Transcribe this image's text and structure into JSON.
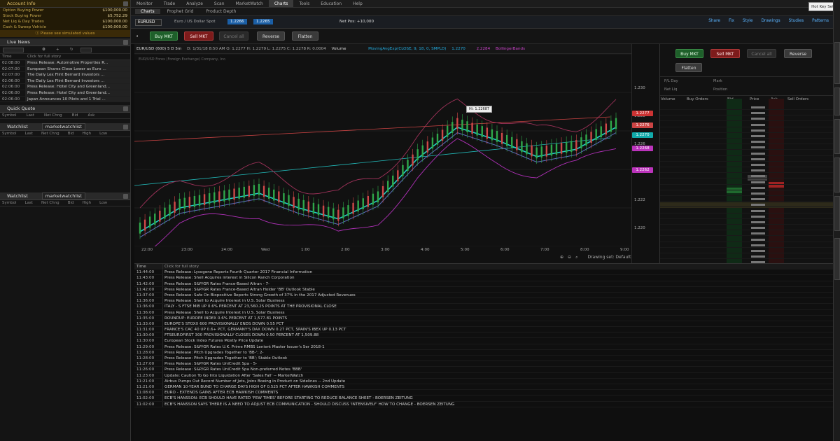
{
  "colors": {
    "buy": "#1e5f2a",
    "sell": "#7d1b1b",
    "accent": "#3aa0d8",
    "teal": "#23d0c8",
    "red_line": "#c44",
    "magenta": "#c030c0"
  },
  "left_panel": {
    "account_title": "Account Info",
    "account_rows": [
      {
        "label": "Option Buying Power",
        "value": "$100,000.00"
      },
      {
        "label": "Stock Buying Power",
        "value": "$5,752.29"
      },
      {
        "label": "Net Liq & Day Trades",
        "value": "$100,000.00"
      },
      {
        "label": "Cash & Sweep Vehicle",
        "value": "$100,000.00"
      }
    ],
    "account_note": "ⓘ Please see simulated values",
    "live_news_title": "Live News",
    "news_header": {
      "time": "Time",
      "headline": "Click for full story"
    },
    "news_items": [
      {
        "time": "02:08:00",
        "headline": "Press Release: Automotive Properties R..."
      },
      {
        "time": "02:07:00",
        "headline": "European Shares Close Lower as Euro ..."
      },
      {
        "time": "02:07:00",
        "headline": "The Daily Lex Flint Bernard Investors ..."
      },
      {
        "time": "02:06:00",
        "headline": "The Daily Lex Flint Bernard Investors ..."
      },
      {
        "time": "02:06:00",
        "headline": "Press Release: Hotel City and Greenland..."
      },
      {
        "time": "02:06:00",
        "headline": "Press Release: Hotel City and Greenland..."
      },
      {
        "time": "02:06:00",
        "headline": "Japan Announces 10 Pilots and 1 Trial ..."
      }
    ],
    "quick_quote_title": "Quick Quote",
    "quick_quote_cols": [
      "Symbol",
      "Last",
      "Net Chng",
      "Bid",
      "Ask"
    ],
    "watchlist1_title": "Watchlist",
    "watchlist1_name": "marketwatchlist",
    "watchlist_cols": [
      "Symbol",
      "Last",
      "Net Chng",
      "Bid",
      "High",
      "Low"
    ],
    "watchlist2_title": "Watchlist",
    "watchlist2_name": "marketwatchlist"
  },
  "menu": {
    "tabs": [
      "Monitor",
      "Trade",
      "Analyze",
      "Scan",
      "MarketWatch",
      "Charts",
      "Tools",
      "Education",
      "Help"
    ],
    "active": "Charts",
    "sub_tabs": [
      "Charts",
      "Prophet Grid",
      "Product Depth"
    ],
    "tooltip": "Hot Key Setu"
  },
  "symbar": {
    "symbol": "EURUSD",
    "desc": "Euro / US Dollar Spot",
    "last": "1.2266",
    "bid": "1.2265",
    "net_pos": "Net Pos: +10,000",
    "tools": [
      "Share",
      "Fix",
      "Style",
      "Drawings",
      "Studies",
      "Patterns"
    ]
  },
  "trade_buttons": {
    "buy": "Buy MKT",
    "sell": "Sell MKT",
    "cancel": "Cancel all",
    "reverse": "Reverse",
    "flatten": "Flatten"
  },
  "chart": {
    "header": "EUR/USD (600) 5 D 5m",
    "ohlc": "D: 1/31/18 8:50 AM   O: 1.2277   H: 1.2279   L: 1.2275   C: 1.2278   R: 0.0004",
    "studies": "Volume",
    "ma_label": "MovingAvgExp(CLOSE, 9, 18, 0, SMPLD)",
    "ma_val": "1.2270",
    "bb_val": "2.2284",
    "bb_label": "BollingerBands",
    "source": "EUR/USD Forex (Foreign Exchange) Company, Inc.",
    "price_label": "Hi: 1.22687",
    "x_ticks": [
      "22:00",
      "23:00",
      "24:00",
      "Wed",
      "1:00",
      "2:00",
      "3:00",
      "4:00",
      "5:00",
      "6:00",
      "7:00",
      "8:00",
      "9:00",
      "4:00",
      "5:00",
      "6:00",
      "7:00",
      "8:00",
      "9:00"
    ],
    "y_ticks": [
      "1.230",
      "1.228",
      "1.226",
      "1.224",
      "1.222",
      "1.220"
    ],
    "y_tags": [
      {
        "text": "1.2277",
        "color": "#c33"
      },
      {
        "text": "1.2276",
        "color": "#c44"
      },
      {
        "text": "1.2270",
        "color": "#1aa"
      },
      {
        "text": "1.2268",
        "color": "#b3b"
      },
      {
        "text": "1.2262",
        "color": "#b3b"
      }
    ],
    "drawing_set": "Drawing set: Default"
  },
  "chart_data": {
    "type": "line",
    "x": [
      "22:00",
      "23:00",
      "24:00",
      "Wed",
      "1:00",
      "2:00",
      "3:00",
      "4:00",
      "5:00",
      "6:00",
      "7:00",
      "8:00",
      "9:00"
    ],
    "series": [
      {
        "name": "",
        "values": [
          1.2205,
          1.2218,
          1.2222,
          1.2226,
          1.2218,
          1.2212,
          1.2222,
          1.2245,
          1.2262,
          1.2255,
          1.2246,
          1.225,
          1.2262
        ]
      }
    ],
    "ylim": [
      1.2195,
      1.23
    ]
  },
  "ladder": {
    "buttons": {
      "buy": "Buy MKT",
      "sell": "Sell MKT",
      "cancel": "Cancel all",
      "reverse": "Reverse",
      "flatten": "Flatten"
    },
    "cols": [
      "Volume",
      "Buy Orders",
      "Bid",
      "Price",
      "Ask",
      "Sell Orders"
    ],
    "info": [
      "P/L Day",
      "Mark",
      "Net Liq",
      "Position"
    ]
  },
  "bottom_news": {
    "header": {
      "time": "Time",
      "headline": "Click for full story"
    },
    "items": [
      {
        "time": "11:44:00",
        "headline": "Press Release: Lysogene Reports Fourth Quarter 2017 Financial Information"
      },
      {
        "time": "11:43:00",
        "headline": "Press Release: Shell Acquires interest in Silicon Ranch Corporation"
      },
      {
        "time": "11:42:00",
        "headline": "Press Release: S&P/GR Rates France-Based Altran - 7-"
      },
      {
        "time": "11:42:00",
        "headline": "Press Release: S&P/GR Rates France-Based Altran Holder 'BB' Outlook Stable"
      },
      {
        "time": "11:37:00",
        "headline": "Press Release: Safe On Biopositive Reports Strong Growth of 37% in the 2017 Adjusted Revenues"
      },
      {
        "time": "11:36:00",
        "headline": "Press Release: Shell to Acquire Interest in U.S. Solar Business"
      },
      {
        "time": "11:36:00",
        "headline": "ITALY - S FTSE MIB UP 0.6% PERCENT AT 23,560.25 POINTS AT THE PROVISIONAL CLOSE"
      },
      {
        "time": "11:36:00",
        "headline": "Press Release: Shell to Acquire Interest in U.S. Solar Business"
      },
      {
        "time": "11:35:00",
        "headline": "ROUNDUP: EUROPE INDEX 0.6% PERCENT AT 1,577.81 POINTS"
      },
      {
        "time": "11:33:00",
        "headline": "EUROPE'S STOXX 600 PROVISIONALLY ENDS DOWN 0.55 PCT"
      },
      {
        "time": "11:31:00",
        "headline": "FRANCE'S CAC 40 UP 0.6+ PCT, GERMANY'S DAX DOWN 0.27 PCT, SPAIN'S IBEX UP 0.13 PCT"
      },
      {
        "time": "11:30:00",
        "headline": "FTSEUROFIRST 300 PROVISIONALLY CLOSES DOWN 0.50 PERCENT AT 1,509.88"
      },
      {
        "time": "11:30:00",
        "headline": "European Stock Index Futures Mostly Price Update"
      },
      {
        "time": "11:29:00",
        "headline": "Press Release: S&P/GR Rates U.K. Prime RMBS Lenient Master Issuer's Ser 2018-1"
      },
      {
        "time": "11:28:00",
        "headline": "Press Release: Pitch Upgrades Together to 'BB-'; 2-"
      },
      {
        "time": "11:28:00",
        "headline": "Press Release: Pitch Upgrades Together to 'BB'; Stable Outlook"
      },
      {
        "time": "11:27:00",
        "headline": "Press Release: S&P/GR Rates UniCredit Spa - 5-"
      },
      {
        "time": "11:26:00",
        "headline": "Press Release: S&P/GR Rates UniCredit Spa Non-preferred Notes 'BBB'"
      },
      {
        "time": "11:23:00",
        "headline": "Update: Caution To Go Into Liquidation After 'Sales Fall' -- MarketWatch"
      },
      {
        "time": "11:21:00",
        "headline": "Airbus Pumps Out Record Number of Jets, Joins Boeing in Product on Sidelines -- 2nd Update"
      },
      {
        "time": "11:21:00",
        "headline": "GERMAN 10-YEAR BUND TO CHARGE DAYS HIGH OF 0.525 PCT AFTER HAWKISH COMMENTS"
      },
      {
        "time": "11:08:00",
        "headline": "EURO - EXTENDS GAINS AFTER ECB HAWKISH COMMENTS"
      },
      {
        "time": "11:02:00",
        "headline": "ECB'S HANSSON: ECB SHOULD HAVE RATED 'FEW TIMES' BEFORE STARTING TO REDUCE BALANCE SHEET - BOERSEN ZEITUNG"
      },
      {
        "time": "11:02:00",
        "headline": "ECB'S HANSSON SAYS THERE IS A NEED TO ADJUST ECB COMMUNICATION - SHOULD DISCUSS 'INTENSIVELY' HOW TO CHANGE - BOERSEN ZEITUNG"
      }
    ]
  }
}
